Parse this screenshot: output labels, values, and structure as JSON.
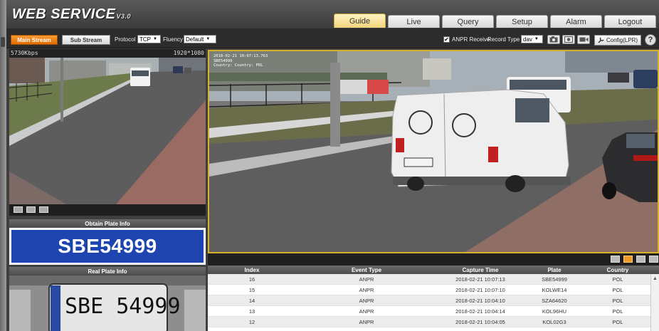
{
  "app": {
    "logo": "WEB SERVICE",
    "version": "V3.0"
  },
  "nav": {
    "tabs": [
      "Guide",
      "Live",
      "Query",
      "Setup",
      "Alarm",
      "Logout"
    ],
    "active": "Guide"
  },
  "toolbar": {
    "main_stream": "Main Stream",
    "sub_stream": "Sub Stream",
    "protocol_label": "Protocol",
    "protocol_value": "TCP",
    "fluency_label": "Fluency",
    "fluency_value": "Default",
    "anpr_checked": "✔",
    "anpr_label": "ANPR Receive",
    "record_type_label": "Record Type",
    "record_type_value": "dav",
    "config_label": "Config(LPR)",
    "help": "?"
  },
  "small_video": {
    "bitrate": "5730Kbps",
    "resolution": "1920*1080"
  },
  "big_video": {
    "osd_lines": [
      "2018-02-21 10:07:13.763",
      "SBE54999",
      "Country: Country: POL"
    ]
  },
  "plate_info": {
    "obtain_header": "Obtain Plate Info",
    "plate_number": "SBE54999",
    "real_header": "Real Plate Info",
    "real_plate_text": "SBE 54999"
  },
  "table": {
    "columns": [
      "Index",
      "Event Type",
      "Capture Time",
      "Plate",
      "Country"
    ],
    "rows": [
      [
        "16",
        "ANPR",
        "2018-02-21 10:07:13",
        "SBE54999",
        "POL"
      ],
      [
        "15",
        "ANPR",
        "2018-02-21 10:07:10",
        "KOLWE14",
        "POL"
      ],
      [
        "14",
        "ANPR",
        "2018-02-21 10:04:10",
        "SZA64620",
        "POL"
      ],
      [
        "13",
        "ANPR",
        "2018-02-21 10:04:14",
        "KOL96HU",
        "POL"
      ],
      [
        "12",
        "ANPR",
        "2018-02-21 10:04:05",
        "KOL02G3",
        "POL"
      ]
    ]
  },
  "colors": {
    "accent_orange": "#f08a1c",
    "plate_blue": "#1e44b0",
    "active_tab": "#f2d47a",
    "selection_border": "#d6b22a"
  }
}
